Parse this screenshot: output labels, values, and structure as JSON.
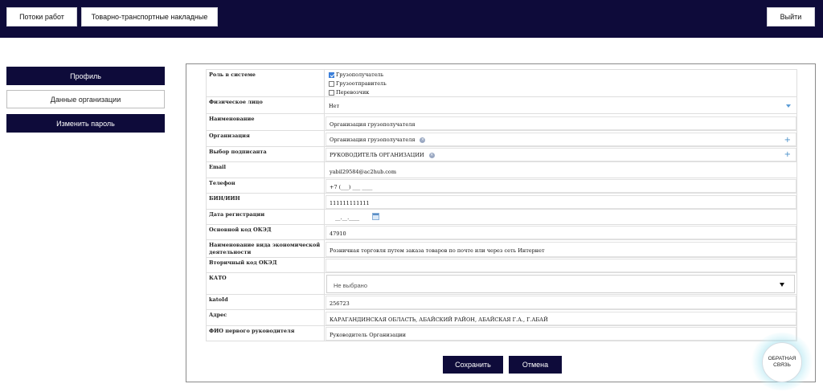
{
  "topbar": {
    "flows_label": "Потоки работ",
    "ttn_label": "Товарно-транспортные накладные",
    "exit_label": "Выйти"
  },
  "sidebar": {
    "items": [
      {
        "label": "Профиль"
      },
      {
        "label": "Данные организации"
      },
      {
        "label": "Изменить пароль"
      }
    ]
  },
  "form": {
    "role": {
      "label": "Роль в системе",
      "options": [
        {
          "label": "Грузополучатель",
          "checked": true
        },
        {
          "label": "Грузоотправитель",
          "checked": false
        },
        {
          "label": "Перевозчик",
          "checked": false
        }
      ]
    },
    "individual": {
      "label": "Физическое лицо",
      "value": "Нет"
    },
    "name": {
      "label": "Наименование",
      "value": "Организация грузополучателя"
    },
    "organization": {
      "label": "Организация",
      "value": "Организация грузополучателя"
    },
    "signer": {
      "label": "Выбор подписанта",
      "value": "РУКОВОДИТЕЛЬ ОРГАНИЗАЦИИ"
    },
    "email": {
      "label": "Email",
      "value": "yabil29584@ac2hub.com"
    },
    "phone": {
      "label": "Телефон",
      "value": "+7 (___) ___ ____"
    },
    "bin": {
      "label": "БИН/ИИН",
      "value": "111111111111"
    },
    "reg_date": {
      "label": "Дата регистрации",
      "value": "__.__.____"
    },
    "okved": {
      "label": "Основной код ОКЭД",
      "value": "47910"
    },
    "activity": {
      "label": "Наименование вида экономической деятельности",
      "value": "Розничная торговля путем заказа товаров по почте или через сеть Интернет"
    },
    "okved2": {
      "label": "Вторичный код ОКЭД",
      "value": ""
    },
    "kato": {
      "label": "КАТО",
      "value": "Не выбрано"
    },
    "katoid": {
      "label": "katoId",
      "value": "256723"
    },
    "address": {
      "label": "Адрес",
      "value": "КАРАГАНДИНСКАЯ ОБЛАСТЬ, АБАЙСКИЙ РАЙОН, АБАЙСКАЯ Г.А., Г.АБАЙ"
    },
    "head": {
      "label": "ФИО первого руководителя",
      "value": "Руководитель Организации"
    }
  },
  "actions": {
    "save_label": "Сохранить",
    "cancel_label": "Отмена"
  },
  "feedback": {
    "line1": "ОБРАТНАЯ",
    "line2": "СВЯЗЬ"
  },
  "colors": {
    "navy": "#0e0b3a",
    "accent": "#3b7fd9"
  }
}
